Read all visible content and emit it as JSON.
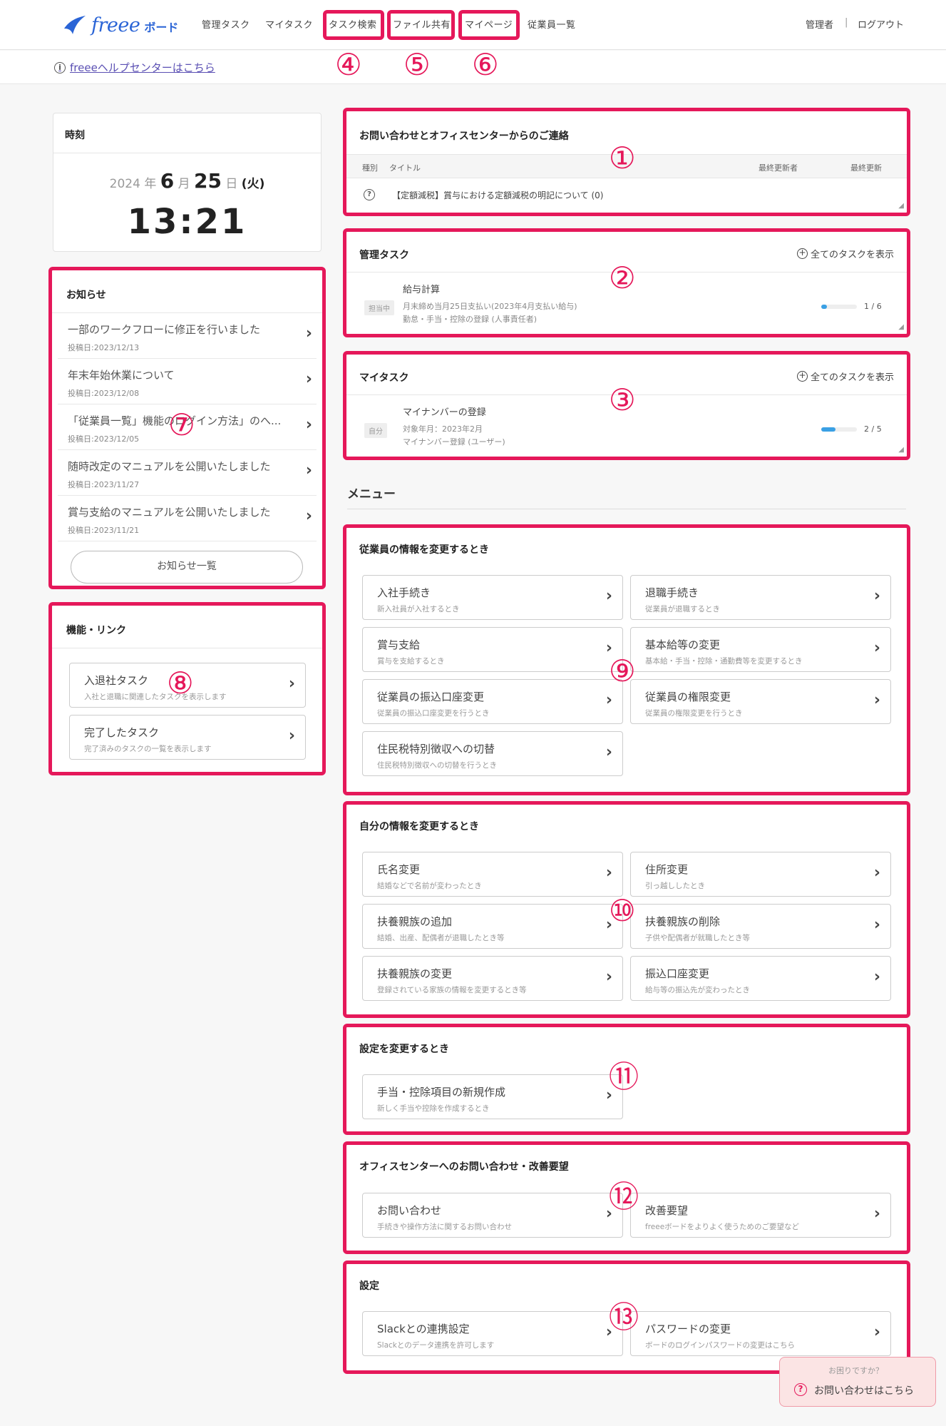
{
  "header": {
    "logo_word": "freee",
    "logo_sub": "ボード",
    "nav": [
      "管理タスク",
      "マイタスク",
      "タスク検索",
      "ファイル共有",
      "マイページ",
      "従業員一覧"
    ],
    "user": "管理者",
    "divider": "|",
    "logout": "ログアウト"
  },
  "help": {
    "info_glyph": "i",
    "label": "freeeヘルプセンターはこちら"
  },
  "annotations": [
    "①",
    "②",
    "③",
    "④",
    "⑤",
    "⑥",
    "⑦",
    "⑧",
    "⑨",
    "⑩",
    "⑪",
    "⑫",
    "⑬"
  ],
  "clock": {
    "title": "時刻",
    "year": "2024",
    "year_unit": "年",
    "month": "6",
    "month_unit": "月",
    "day": "25",
    "day_unit": "日",
    "dow": "(火)",
    "time": "13:21"
  },
  "news": {
    "title": "お知らせ",
    "items": [
      {
        "title": "一部のワークフローに修正を行いました",
        "date": "投稿日:2023/12/13"
      },
      {
        "title": "年末年始休業について",
        "date": "投稿日:2023/12/08"
      },
      {
        "title": "「従業員一覧」機能のログイン方法」のへ...",
        "date": "投稿日:2023/12/05"
      },
      {
        "title": "随時改定のマニュアルを公開いたしました",
        "date": "投稿日:2023/11/27"
      },
      {
        "title": "賞与支給のマニュアルを公開いたしました",
        "date": "投稿日:2023/11/21"
      }
    ],
    "all_button": "お知らせ一覧"
  },
  "links": {
    "title": "機能・リンク",
    "items": [
      {
        "title": "入退社タスク",
        "sub": "入社と退職に関連したタスクを表示します"
      },
      {
        "title": "完了したタスク",
        "sub": "完了済みのタスクの一覧を表示します"
      }
    ]
  },
  "contact": {
    "title": "お問い合わせとオフィスセンターからのご連絡",
    "col_type": "種別",
    "col_title": "タイトル",
    "col_updater": "最終更新者",
    "col_updated": "最終更新",
    "row_icon": "?",
    "row_title": "【定額減税】賞与における定額減税の明記について (0)"
  },
  "admin_tasks": {
    "title": "管理タスク",
    "show_all": "全てのタスクを表示",
    "plus": "+",
    "task_title": "給与計算",
    "tag": "担当中",
    "line1": "月末締め当月25日支払い(2023年4月支払い給与)",
    "line2": "勤怠・手当・控除の登録 (人事責任者)",
    "progress": 0.167,
    "ratio": "1 / 6"
  },
  "my_tasks": {
    "title": "マイタスク",
    "show_all": "全てのタスクを表示",
    "plus": "+",
    "task_title": "マイナンバーの登録",
    "tag": "自分",
    "line1": "対象年月：2023年2月",
    "line2": "マイナンバー登録 (ユーザー)",
    "progress": 0.4,
    "ratio": "2 / 5"
  },
  "menu": {
    "title": "メニュー",
    "employee": {
      "title": "従業員の情報を変更するとき",
      "items": [
        {
          "title": "入社手続き",
          "sub": "新入社員が入社するとき"
        },
        {
          "title": "退職手続き",
          "sub": "従業員が退職するとき"
        },
        {
          "title": "賞与支給",
          "sub": "賞与を支給するとき"
        },
        {
          "title": "基本給等の変更",
          "sub": "基本給・手当・控除・通勤費等を変更するとき"
        },
        {
          "title": "従業員の振込口座変更",
          "sub": "従業員の振込口座変更を行うとき"
        },
        {
          "title": "従業員の権限変更",
          "sub": "従業員の権限変更を行うとき"
        },
        {
          "title": "住民税特別徴収への切替",
          "sub": "住民税特別徴収への切替を行うとき"
        }
      ]
    },
    "self": {
      "title": "自分の情報を変更するとき",
      "items": [
        {
          "title": "氏名変更",
          "sub": "結婚などで名前が変わったとき"
        },
        {
          "title": "住所変更",
          "sub": "引っ越ししたとき"
        },
        {
          "title": "扶養親族の追加",
          "sub": "結婚、出産、配偶者が退職したとき等"
        },
        {
          "title": "扶養親族の削除",
          "sub": "子供や配偶者が就職したとき等"
        },
        {
          "title": "扶養親族の変更",
          "sub": "登録されている家族の情報を変更するとき等"
        },
        {
          "title": "振込口座変更",
          "sub": "給与等の振込先が変わったとき"
        }
      ]
    },
    "settings_change": {
      "title": "設定を変更するとき",
      "items": [
        {
          "title": "手当・控除項目の新規作成",
          "sub": "新しく手当や控除を作成するとき"
        }
      ]
    },
    "office": {
      "title": "オフィスセンターへのお問い合わせ・改善要望",
      "items": [
        {
          "title": "お問い合わせ",
          "sub": "手続きや操作方法に関するお問い合わせ"
        },
        {
          "title": "改善要望",
          "sub": "freeeボードをよりよく使うためのご要望など"
        }
      ]
    },
    "settings": {
      "title": "設定",
      "items": [
        {
          "title": "Slackとの連携設定",
          "sub": "Slackとのデータ連携を許可します"
        },
        {
          "title": "パスワードの変更",
          "sub": "ボードのログインパスワードの変更はこちら"
        }
      ]
    }
  },
  "float_help": {
    "top": "お困りですか？",
    "icon": "?",
    "label": "お問い合わせはこちら"
  },
  "chevron": "›",
  "resize_glyph": "◢",
  "colors": {
    "highlight": "#e5185a",
    "brand": "#2a64d6",
    "progress": "#3aa0e4"
  }
}
